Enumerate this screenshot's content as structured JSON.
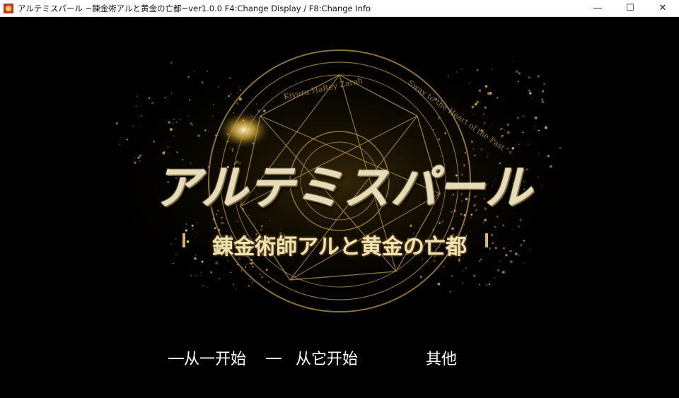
{
  "window": {
    "title": "アルテミスパール ~錬金術アルと黄金の亡都~ver1.0.0     F4:Change Display / F8:Change Info",
    "minimize": "—",
    "maximize": "☐",
    "close": "✕"
  },
  "logo": {
    "title": "アルテミスパール",
    "subtitle": "錬金術師アルと黄金の亡都",
    "circle_text_top": "Kiyura HaRey Zarah",
    "circle_text_right": "Sway to the Heart of the Past"
  },
  "menu": {
    "items": [
      {
        "label": "从一开始"
      },
      {
        "label": "从它开始"
      },
      {
        "label": "其他"
      }
    ]
  },
  "colors": {
    "gold": "#c9a33a",
    "background": "#000000",
    "menu_text": "#ffffff"
  }
}
